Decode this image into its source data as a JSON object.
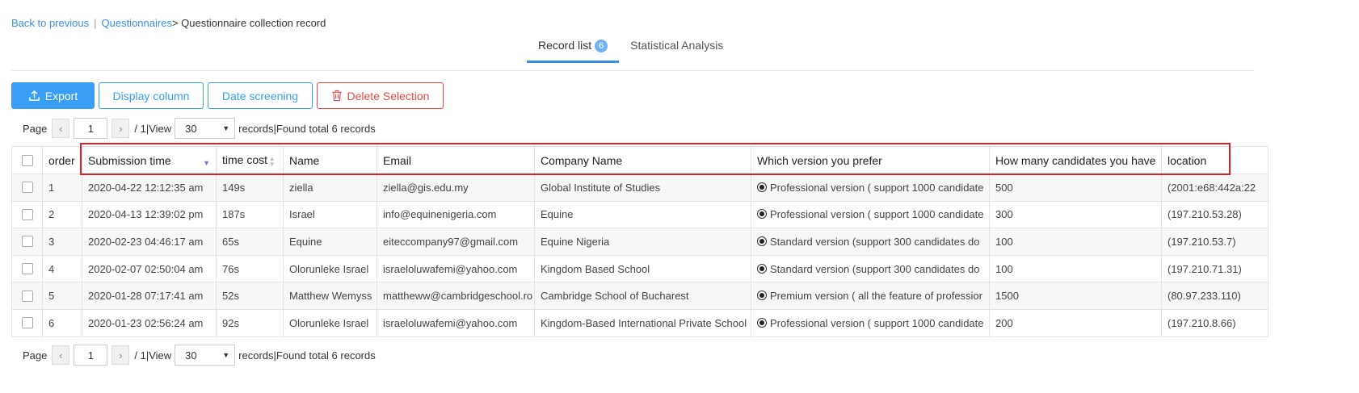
{
  "breadcrumb": {
    "back": "Back to previous",
    "separator": "|",
    "parent": "Questionnaires",
    "current": "> Questionnaire collection record"
  },
  "tabs": [
    {
      "label": "Record list",
      "badge": "6",
      "active": true
    },
    {
      "label": "Statistical Analysis",
      "active": false
    }
  ],
  "toolbar": {
    "export": "Export",
    "display_column": "Display column",
    "date_screening": "Date screening",
    "delete_selection": "Delete Selection"
  },
  "pager": {
    "page_label": "Page",
    "current_page": "1",
    "total_pages": "/ 1",
    "view_label": "|View",
    "page_size": "30",
    "records_text": "records|Found total 6 records"
  },
  "table": {
    "headers": {
      "order": "order",
      "submission_time": "Submission time",
      "time_cost": "time cost",
      "name": "Name",
      "email": "Email",
      "company": "Company Name",
      "version": "Which version you prefer",
      "candidates": "How many candidates you have",
      "location": "location"
    },
    "rows": [
      {
        "order": "1",
        "submission_time": "2020-04-22 12:12:35 am",
        "time_cost": "149s",
        "name": "ziella",
        "email": "ziella@gis.edu.my",
        "company": "Global Institute of Studies",
        "version": "Professional version ( support 1000 candidate",
        "candidates": "500",
        "location": "(2001:e68:442a:22"
      },
      {
        "order": "2",
        "submission_time": "2020-04-13 12:39:02 pm",
        "time_cost": "187s",
        "name": "Israel",
        "email": "info@equinenigeria.com",
        "company": "Equine",
        "version": "Professional version ( support 1000 candidate",
        "candidates": "300",
        "location": "(197.210.53.28)"
      },
      {
        "order": "3",
        "submission_time": "2020-02-23 04:46:17 am",
        "time_cost": "65s",
        "name": "Equine",
        "email": "eiteccompany97@gmail.com",
        "company": "Equine Nigeria",
        "version": "Standard version (support 300 candidates do",
        "candidates": "100",
        "location": "(197.210.53.7)"
      },
      {
        "order": "4",
        "submission_time": "2020-02-07 02:50:04 am",
        "time_cost": "76s",
        "name": "Olorunleke Israel",
        "email": "israeloluwafemi@yahoo.com",
        "company": "Kingdom Based School",
        "version": "Standard version (support 300 candidates do",
        "candidates": "100",
        "location": "(197.210.71.31)"
      },
      {
        "order": "5",
        "submission_time": "2020-01-28 07:17:41 am",
        "time_cost": "52s",
        "name": "Matthew Wemyss",
        "email": "mattheww@cambridgeschool.ro",
        "company": "Cambridge School of Bucharest",
        "version": "Premium version ( all the feature of professior",
        "candidates": "1500",
        "location": "(80.97.233.110)"
      },
      {
        "order": "6",
        "submission_time": "2020-01-23 02:56:24 am",
        "time_cost": "92s",
        "name": "Olorunleke Israel",
        "email": "israeloluwafemi@yahoo.com",
        "company": "Kingdom-Based International Private School",
        "version": "Professional version ( support 1000 candidate",
        "candidates": "200",
        "location": "(197.210.8.66)"
      }
    ]
  },
  "colors": {
    "accent": "#3a9ef5",
    "danger": "#e84848",
    "highlight": "#e02020"
  }
}
